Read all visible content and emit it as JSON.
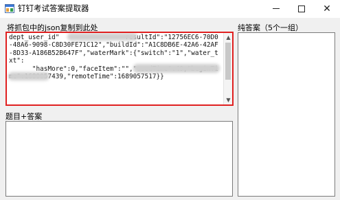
{
  "window": {
    "title": "钉钉考试答案提取器",
    "minimize_glyph": "—",
    "maximize_glyph": "□",
    "close_glyph": "✕"
  },
  "labels": {
    "json_label": "将抓包中的json复制到此处",
    "qa_label": "题目+答案",
    "pure_label": "纯答案（5个一组）"
  },
  "json_input": {
    "value": "dept_user_id\"                 resultId\":\"12756EC6-70D0-48A6-9098-C8D30FE71C12\",\"buildId\":\"A1C8DB6E-42A6-42AF-8D33-A186B52B647F\",\"waterMark\":{\"switch\":\"1\",\"water_txt\":                         \n      \"hasMore\":0,\"faceItem\":\"\",\"usedTime\":49,\"beginTime\":1689057439,\"remoteTime\":1689057517}}"
  },
  "qa_output": {
    "value": ""
  },
  "pure_output": {
    "value": ""
  },
  "colors": {
    "highlight_border": "#e02020",
    "client_background": "#f0f0f0"
  },
  "icons": {
    "app": "app-icon",
    "scroll_up": "chevron-up-icon",
    "scroll_down": "chevron-down-icon"
  }
}
